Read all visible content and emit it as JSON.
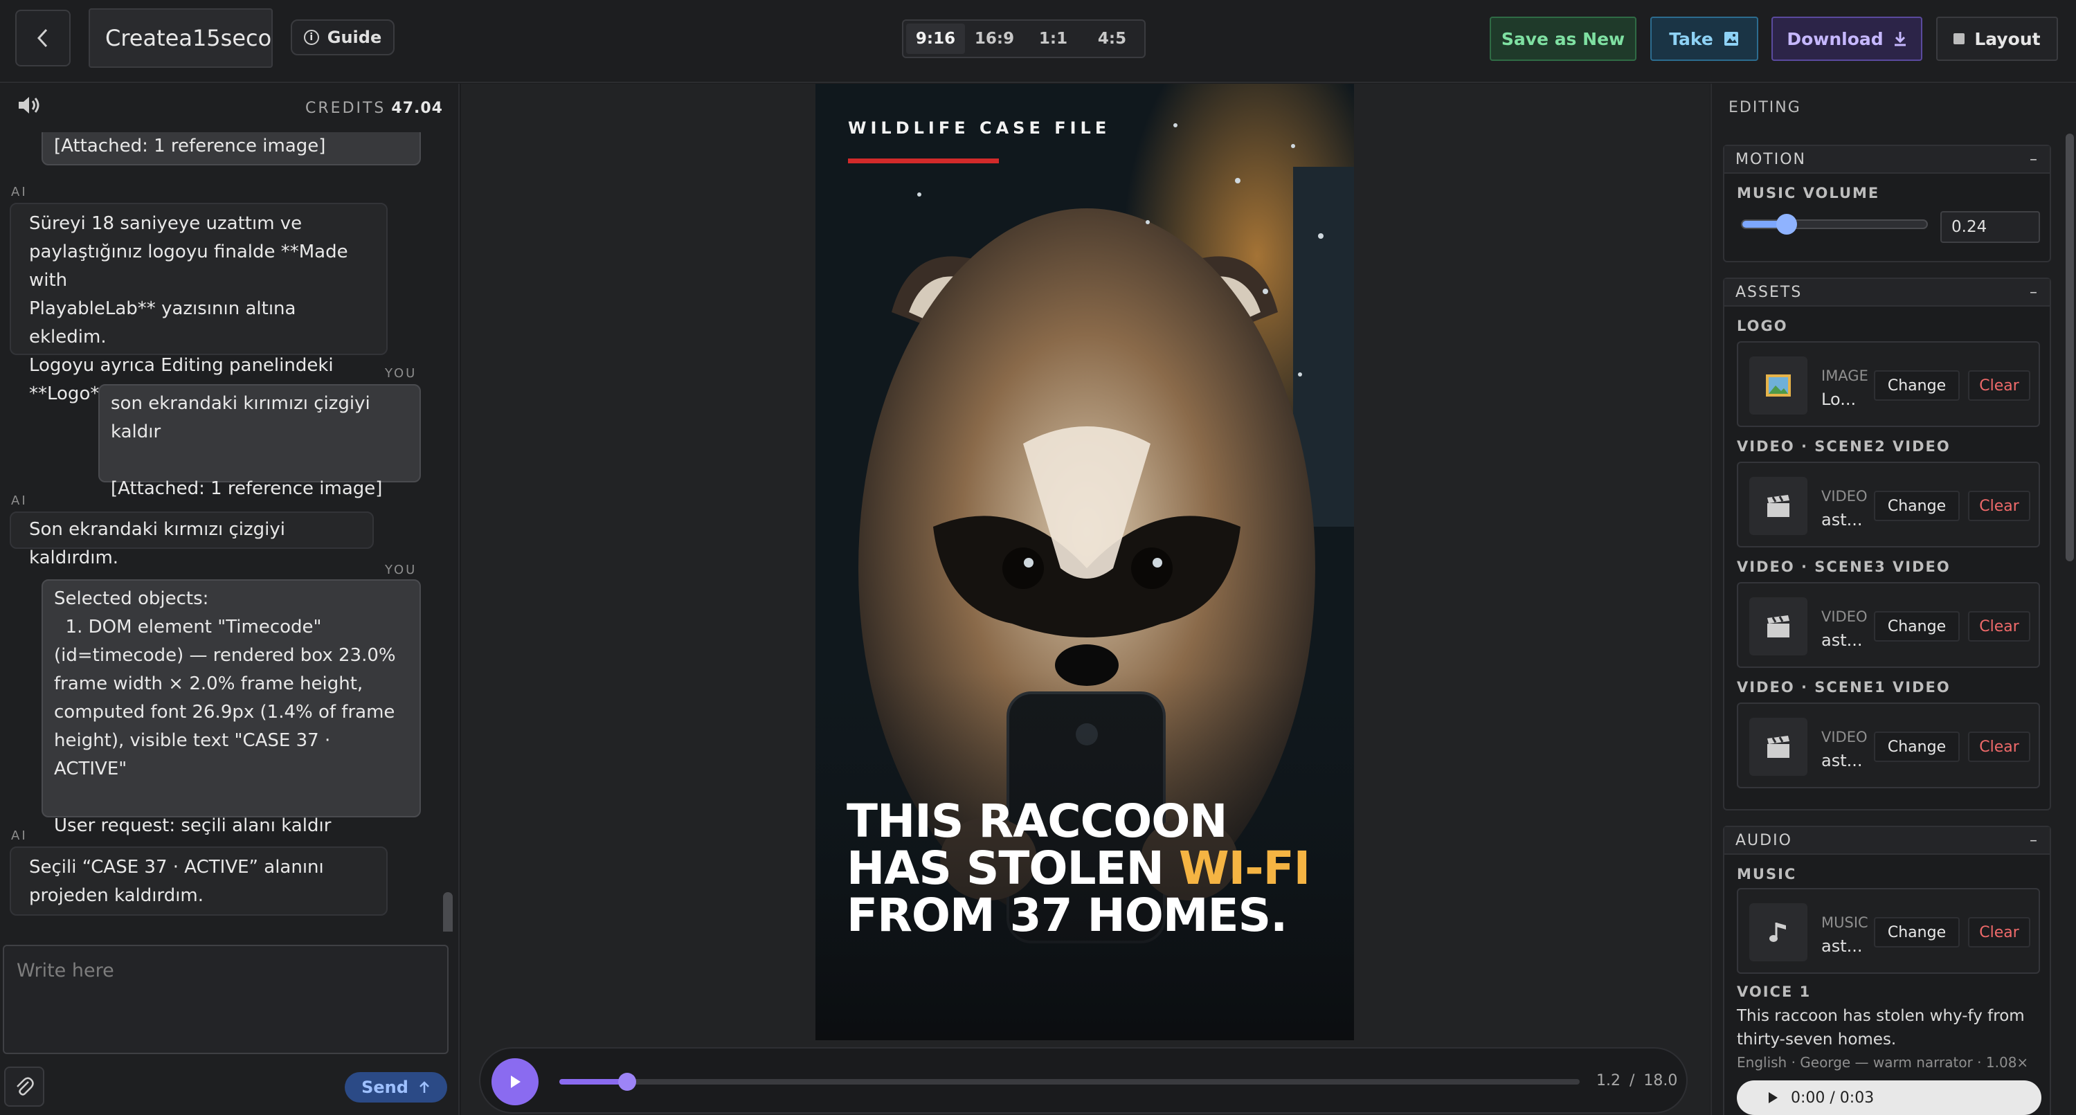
{
  "header": {
    "back_icon": "chevron-left-icon",
    "project_title": "Createa15seco",
    "guide_label": "Guide",
    "ratios": [
      "9:16",
      "16:9",
      "1:1",
      "4:5"
    ],
    "active_ratio": "9:16",
    "save_new_label": "Save as New",
    "take_label": "Take",
    "download_label": "Download",
    "layout_label": "Layout"
  },
  "chat": {
    "credits_label": "CREDITS",
    "credits_value": "47.04",
    "messages": [
      {
        "role": "",
        "text": "[Attached: 1 reference image]"
      },
      {
        "role": "AI",
        "text": "Süreyi 18 saniyeye uzattım ve\npaylaştığınız logoyu finalde **Made with\nPlayableLab** yazısının altına ekledim.\nLogoyu ayrıca Editing panelindeki\n**Logo** alanından değiştirebilirsiniz."
      },
      {
        "role": "YOU",
        "text": "son ekrandaki kırımızı çizgiyi kaldır\n\n[Attached: 1 reference image]"
      },
      {
        "role": "AI",
        "text": "Son ekrandaki kırmızı çizgiyi kaldırdım."
      },
      {
        "role": "YOU",
        "text": "Selected objects:\n  1. DOM element \"Timecode\"\n(id=timecode) — rendered box 23.0%\nframe width × 2.0% frame height,\ncomputed font 26.9px (1.4% of frame\nheight), visible text \"CASE 37 · ACTIVE\"\n\nUser request: seçili alanı kaldır"
      },
      {
        "role": "AI",
        "text": "Seçili “CASE 37 · ACTIVE” alanını\nprojeden kaldırdım."
      }
    ],
    "input_placeholder": "Write here",
    "send_label": "Send"
  },
  "preview": {
    "case_label": "WILDLIFE CASE FILE",
    "headline_line1": "THIS RACCOON",
    "headline_line2a": "HAS STOLEN ",
    "headline_line2b": "WI-FI",
    "headline_line3": "FROM 37 HOMES.",
    "accent_color": "#f5b443",
    "line_color": "#d22a2a"
  },
  "player": {
    "current_time": "1.2",
    "separator": "/",
    "total_time": "18.0",
    "progress": 0.0667
  },
  "editing": {
    "title": "EDITING",
    "motion": {
      "header": "MOTION",
      "music_volume_label": "MUSIC VOLUME",
      "music_volume": "0.24",
      "music_volume_fraction": 0.24
    },
    "assets": {
      "header": "ASSETS",
      "items": [
        {
          "label": "LOGO",
          "type": "IMAGE",
          "name": "Lo...",
          "icon": "image-icon"
        },
        {
          "label": "VIDEO · SCENE2 VIDEO",
          "type": "VIDEO",
          "name": "ast...",
          "icon": "clapperboard-icon"
        },
        {
          "label": "VIDEO · SCENE3 VIDEO",
          "type": "VIDEO",
          "name": "ast...",
          "icon": "clapperboard-icon"
        },
        {
          "label": "VIDEO · SCENE1 VIDEO",
          "type": "VIDEO",
          "name": "ast...",
          "icon": "clapperboard-icon"
        }
      ],
      "change_label": "Change",
      "clear_label": "Clear"
    },
    "audio": {
      "header": "AUDIO",
      "music_label": "MUSIC",
      "music_type": "MUSIC",
      "music_name": "ast...",
      "voice_label": "VOICE 1",
      "voice_text": "This raccoon has stolen why-fy from thirty-seven homes.",
      "voice_meta": "English · George — warm narrator · 1.08×",
      "audio_time": "0:00 / 0:03"
    },
    "collapse_symbol": "–"
  }
}
